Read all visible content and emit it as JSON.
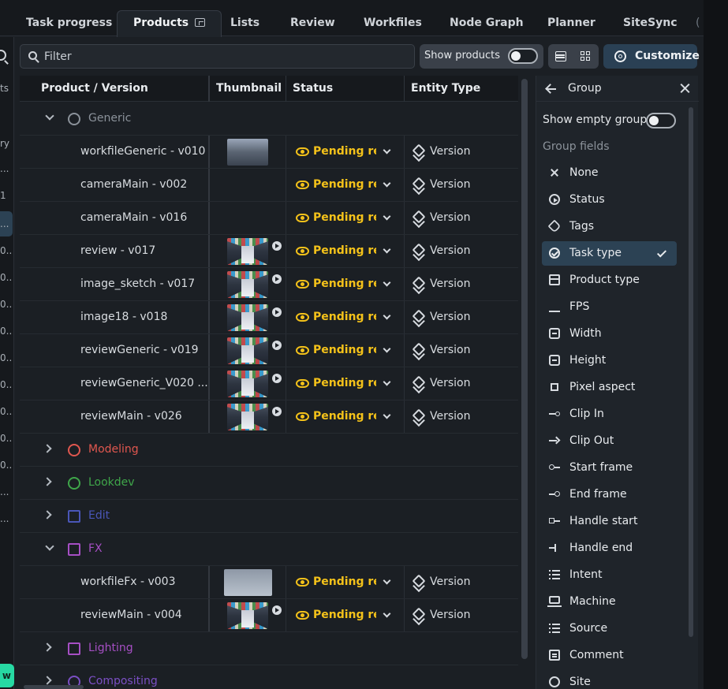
{
  "tabs": [
    {
      "label": "Task progress"
    },
    {
      "label": "Products",
      "active": true
    },
    {
      "label": "Lists"
    },
    {
      "label": "Review"
    },
    {
      "label": "Workfiles"
    },
    {
      "label": "Node Graph"
    },
    {
      "label": "Planner"
    },
    {
      "label": "SiteSync"
    },
    {
      "label": "("
    }
  ],
  "left_sidebar": {
    "items": [
      "ts",
      "ry",
      "...",
      "1",
      "...",
      "0...",
      "0...",
      "0...",
      "0...",
      "0...",
      "0...",
      "0...",
      "0...",
      "0...",
      "...",
      "..."
    ],
    "button_label": "w"
  },
  "toolbar": {
    "filter_placeholder": "Filter",
    "show_products_label": "Show products",
    "show_products_on": false,
    "customize_label": "Customize"
  },
  "table": {
    "columns": [
      "Product / Version",
      "Thumbnail",
      "Status",
      "Entity Type"
    ],
    "groups": [
      {
        "name": "Generic",
        "color": "#8b929a",
        "expanded": true,
        "rows": [
          {
            "name": "workfileGeneric - v010",
            "thumb": "hall",
            "play": false,
            "status": "Pending review",
            "type": "Version"
          },
          {
            "name": "cameraMain - v002",
            "thumb": "",
            "play": false,
            "status": "Pending review",
            "type": "Version"
          },
          {
            "name": "cameraMain - v016",
            "thumb": "",
            "play": false,
            "status": "Pending review",
            "type": "Version"
          },
          {
            "name": "review - v017",
            "thumb": "store",
            "play": true,
            "status": "Pending review",
            "type": "Version"
          },
          {
            "name": "image_sketch - v017",
            "thumb": "store",
            "play": true,
            "status": "Pending review",
            "type": "Version"
          },
          {
            "name": "image18 - v018",
            "thumb": "store",
            "play": true,
            "status": "Pending review",
            "type": "Version"
          },
          {
            "name": "reviewGeneric - v019",
            "thumb": "store",
            "play": true,
            "status": "Pending review",
            "type": "Version"
          },
          {
            "name": "reviewGeneric_V020 ...",
            "thumb": "store",
            "play": true,
            "status": "Pending review",
            "type": "Version"
          },
          {
            "name": "reviewMain - v026",
            "thumb": "store",
            "play": true,
            "status": "Pending review",
            "type": "Version"
          }
        ]
      },
      {
        "name": "Modeling",
        "color": "#e0574f",
        "expanded": false,
        "rows": []
      },
      {
        "name": "Lookdev",
        "color": "#3fa64a",
        "expanded": false,
        "rows": []
      },
      {
        "name": "Edit",
        "color": "#4a56b8",
        "expanded": false,
        "rows": []
      },
      {
        "name": "FX",
        "color": "#a64fc4",
        "expanded": true,
        "rows": [
          {
            "name": "workfileFx - v003",
            "thumb": "sky",
            "play": false,
            "status": "Pending review",
            "type": "Version"
          },
          {
            "name": "reviewMain - v004",
            "thumb": "store",
            "play": true,
            "status": "Pending review",
            "type": "Version"
          }
        ]
      },
      {
        "name": "Lighting",
        "color": "#a64fc4",
        "expanded": false,
        "rows": []
      },
      {
        "name": "Compositing",
        "color": "#7b4fc4",
        "expanded": false,
        "rows": []
      }
    ]
  },
  "group_panel": {
    "title": "Group",
    "show_empty_groups_label": "Show empty groups",
    "show_empty_groups_on": false,
    "group_fields_label": "Group fields",
    "fields": [
      {
        "label": "None",
        "icon": "x"
      },
      {
        "label": "Status",
        "icon": "circle-arrow"
      },
      {
        "label": "Tags",
        "icon": "tag"
      },
      {
        "label": "Task type",
        "icon": "check-circle",
        "selected": true
      },
      {
        "label": "Product type",
        "icon": "box"
      },
      {
        "label": "FPS",
        "icon": "fps"
      },
      {
        "label": "Width",
        "icon": "frame"
      },
      {
        "label": "Height",
        "icon": "frame"
      },
      {
        "label": "Pixel aspect",
        "icon": "square"
      },
      {
        "label": "Clip In",
        "icon": "clip"
      },
      {
        "label": "Clip Out",
        "icon": "clipout"
      },
      {
        "label": "Start frame",
        "icon": "start"
      },
      {
        "label": "End frame",
        "icon": "end"
      },
      {
        "label": "Handle start",
        "icon": "hstart"
      },
      {
        "label": "Handle end",
        "icon": "hend"
      },
      {
        "label": "Intent",
        "icon": "list"
      },
      {
        "label": "Machine",
        "icon": "machine"
      },
      {
        "label": "Source",
        "icon": "list"
      },
      {
        "label": "Comment",
        "icon": "comment"
      },
      {
        "label": "Site",
        "icon": "site"
      }
    ]
  }
}
